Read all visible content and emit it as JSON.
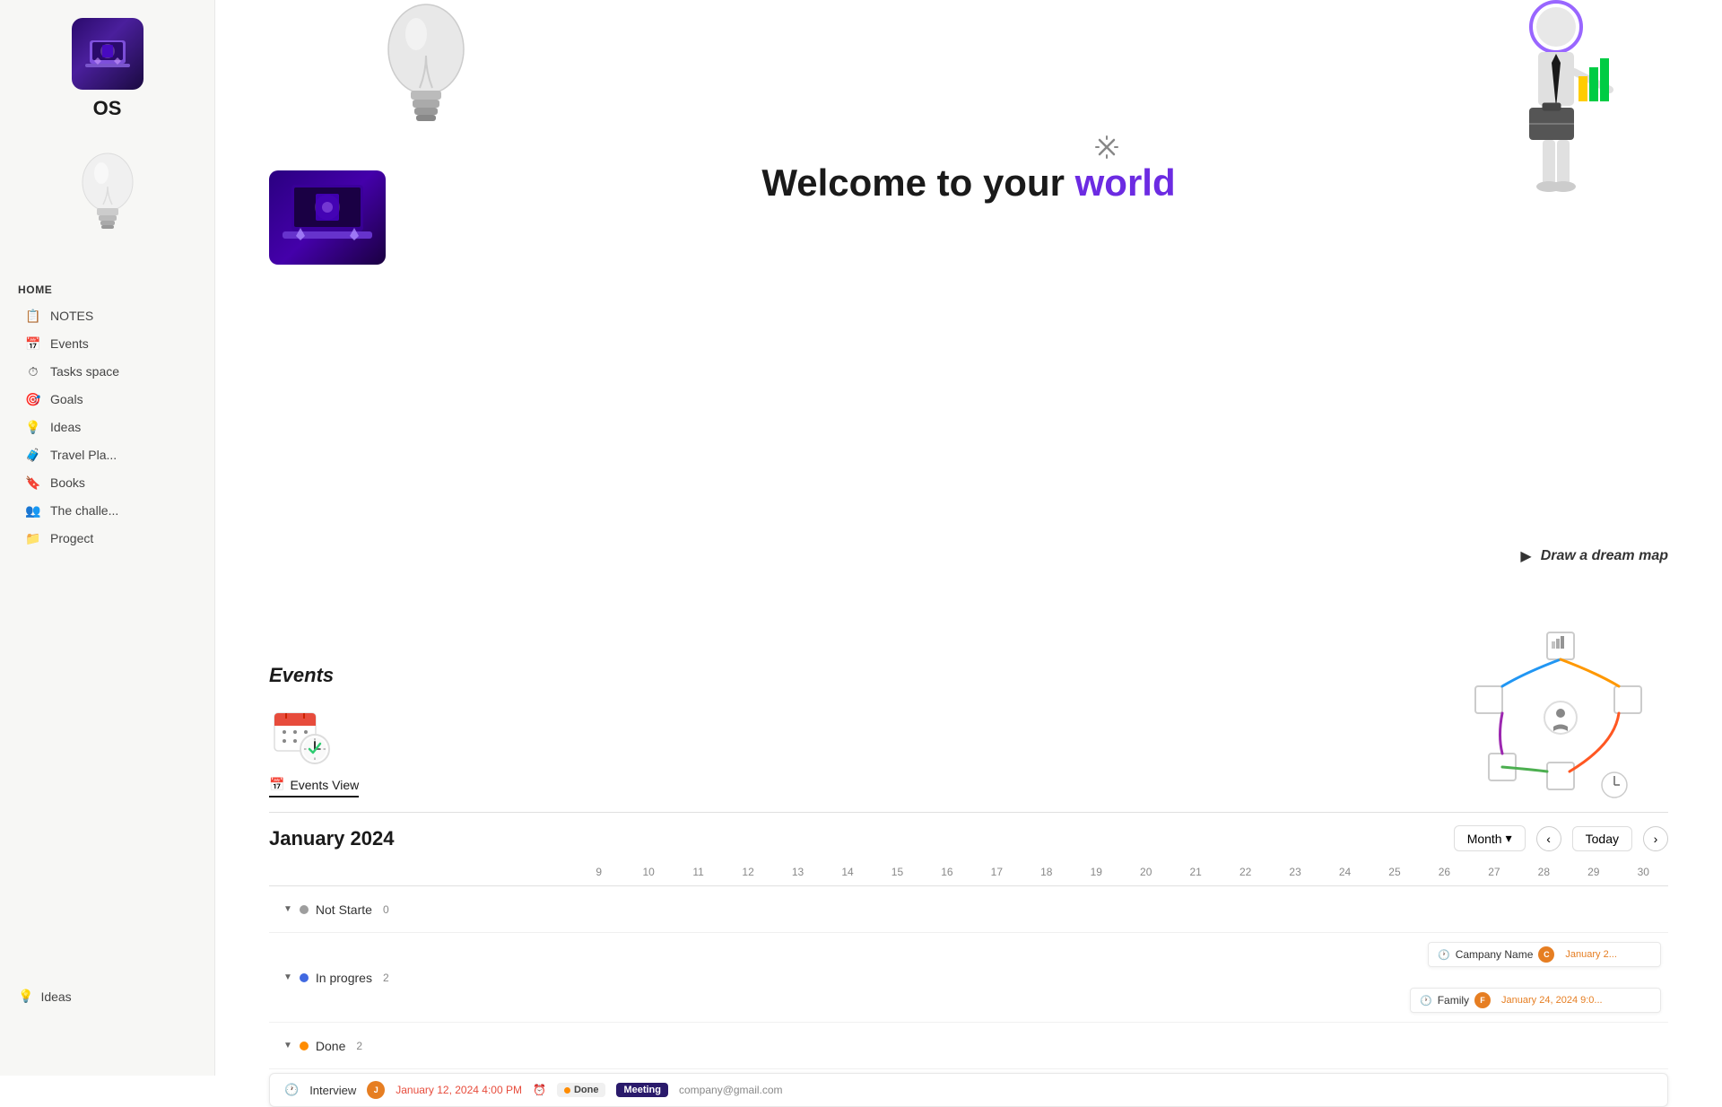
{
  "sidebar": {
    "logo_alt": "OS workspace logo",
    "title": "OS",
    "home_label": "HOME",
    "items": [
      {
        "id": "notes",
        "label": "NOTES",
        "icon": "📋"
      },
      {
        "id": "events",
        "label": "Events",
        "icon": "📅"
      },
      {
        "id": "tasks",
        "label": "Tasks space",
        "icon": "⏱"
      },
      {
        "id": "goals",
        "label": "Goals",
        "icon": "🎯"
      },
      {
        "id": "ideas",
        "label": "Ideas",
        "icon": "💡"
      },
      {
        "id": "travel",
        "label": "Travel Pla...",
        "icon": "🧳"
      },
      {
        "id": "books",
        "label": "Books",
        "icon": "🔖"
      },
      {
        "id": "challenge",
        "label": "The challe...",
        "icon": "👥"
      },
      {
        "id": "project",
        "label": "Progect",
        "icon": "📁"
      }
    ]
  },
  "hero": {
    "title_prefix": "Welcome to your ",
    "title_highlight": "world",
    "close_icon": "✕"
  },
  "events": {
    "section_title": "Events",
    "view_tab_label": "Events View",
    "calendar_month": "January 2024",
    "month_btn_label": "Month",
    "today_btn_label": "Today",
    "days": [
      "9",
      "10",
      "11",
      "12",
      "13",
      "14",
      "15",
      "16",
      "17",
      "18",
      "19",
      "20",
      "21",
      "22",
      "23",
      "24",
      "25",
      "26",
      "27",
      "28",
      "29",
      "30"
    ],
    "groups": [
      {
        "id": "not-started",
        "status": "Not Starte",
        "dot_color": "dot-gray",
        "count": "0",
        "events": []
      },
      {
        "id": "in-progress",
        "status": "In progres",
        "dot_color": "dot-blue",
        "count": "2",
        "events": [
          {
            "icon": "🕐",
            "name": "Campany Name",
            "avatar_initials": "C",
            "avatar_color": "#e67e22",
            "date": "January 2..."
          },
          {
            "icon": "🕐",
            "name": "Family",
            "avatar_initials": "F",
            "avatar_color": "#e67e22",
            "date": "January 24, 2024 9:0..."
          }
        ]
      },
      {
        "id": "done",
        "status": "Done",
        "dot_color": "dot-orange",
        "count": "2",
        "events": []
      }
    ],
    "bottom_event": {
      "clock_icon": "🕐",
      "label": "Interview",
      "avatar_initials": "J",
      "avatar_color": "#e67e22",
      "date": "January 12, 2024 4:00 PM",
      "alarm_icon": "⏰",
      "status_label": "Done",
      "status_dot_color": "#ff8c00",
      "meeting_label": "Meeting",
      "email": "company@gmail.com"
    }
  },
  "dream_map": {
    "label": "Draw a dream map"
  },
  "ideas_sidebar": {
    "label": "Ideas"
  }
}
